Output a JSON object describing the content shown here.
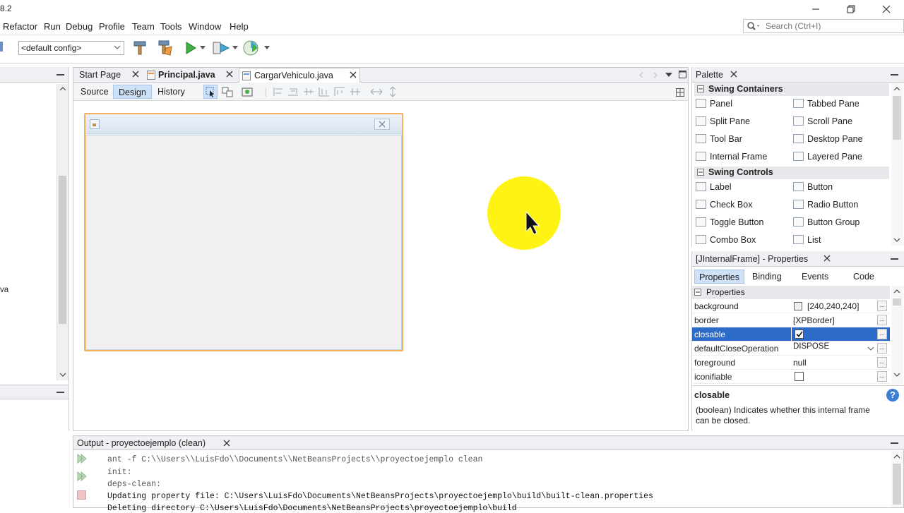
{
  "window": {
    "title": "8.2"
  },
  "menubar": {
    "items": [
      "Refactor",
      "Run",
      "Debug",
      "Profile",
      "Team",
      "Tools",
      "Window",
      "Help"
    ]
  },
  "search": {
    "placeholder": "Search (Ctrl+I)"
  },
  "toolbar": {
    "config": "<default config>"
  },
  "left_panel": {
    "truncated_label": "va"
  },
  "editor": {
    "tabs": [
      "Start Page",
      "Principal.java",
      "CargarVehiculo.java"
    ],
    "active_tab": "CargarVehiculo.java",
    "subtabs": [
      "Source",
      "Design",
      "History"
    ],
    "active_subtab": "Design"
  },
  "palette": {
    "title": "Palette",
    "categories": [
      {
        "name": "Swing Containers",
        "items": [
          "Panel",
          "Tabbed Pane",
          "Split Pane",
          "Scroll Pane",
          "Tool Bar",
          "Desktop Pane",
          "Internal Frame",
          "Layered Pane"
        ]
      },
      {
        "name": "Swing Controls",
        "items": [
          "Label",
          "Button",
          "Check Box",
          "Radio Button",
          "Toggle Button",
          "Button Group",
          "Combo Box",
          "List"
        ]
      }
    ]
  },
  "properties": {
    "title": "[JInternalFrame] - Properties",
    "tabs": [
      "Properties",
      "Binding",
      "Events",
      "Code"
    ],
    "active_tab": "Properties",
    "section": "Properties",
    "rows": [
      {
        "name": "background",
        "value": "[240,240,240]"
      },
      {
        "name": "border",
        "value": "[XPBorder]"
      },
      {
        "name": "closable",
        "value": ""
      },
      {
        "name": "defaultCloseOperation",
        "value": "DISPOSE"
      },
      {
        "name": "foreground",
        "value": "null"
      },
      {
        "name": "iconifiable",
        "value": ""
      }
    ],
    "selected": "closable",
    "help_title": "closable",
    "help_text": "(boolean) Indicates whether this internal frame can be closed."
  },
  "output": {
    "title": "Output - proyectoejemplo (clean)",
    "lines": [
      "ant -f C:\\\\Users\\\\LuisFdo\\\\Documents\\\\NetBeansProjects\\\\proyectoejemplo clean",
      "init:",
      "deps-clean:",
      "Updating property file: C:\\Users\\LuisFdo\\Documents\\NetBeansProjects\\proyectoejemplo\\build\\built-clean.properties",
      "Deleting directory C:\\Users\\LuisFdo\\Documents\\NetBeansProjects\\proyectoejemplo\\build"
    ]
  },
  "colors": {
    "accent": "#2d6bc8",
    "frame_border": "#f2b15f",
    "highlight": "#fff200"
  }
}
